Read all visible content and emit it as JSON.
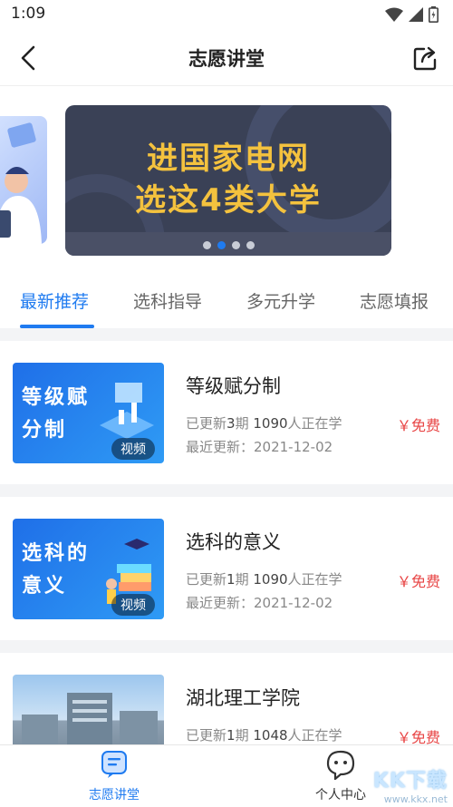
{
  "status": {
    "time": "1:09"
  },
  "header": {
    "title": "志愿讲堂"
  },
  "banner": {
    "line1": "进国家电网",
    "line2": "选这4类大学"
  },
  "tabs": [
    "最新推荐",
    "选科指导",
    "多元升学",
    "志愿填报"
  ],
  "courses": [
    {
      "thumb_text1": "等级赋",
      "thumb_text2": "分制",
      "badge": "视频",
      "title": "等级赋分制",
      "updated_prefix": "已更新",
      "updated_count": "3",
      "updated_unit": "期",
      "learners": "1090",
      "learners_suffix": "人正在学",
      "date": "最近更新：2021-12-02",
      "price": "￥免费"
    },
    {
      "thumb_text1": "选科的",
      "thumb_text2": "意义",
      "badge": "视频",
      "title": "选科的意义",
      "updated_prefix": "已更新",
      "updated_count": "1",
      "updated_unit": "期",
      "learners": "1090",
      "learners_suffix": "人正在学",
      "date": "最近更新：2021-12-02",
      "price": "￥免费"
    },
    {
      "title": "湖北理工学院",
      "updated_prefix": "已更新",
      "updated_count": "1",
      "updated_unit": "期",
      "learners": "1048",
      "learners_suffix": "人正在学",
      "price": "￥免费"
    }
  ],
  "tabbar": {
    "lecture": "志愿讲堂",
    "profile": "个人中心"
  },
  "watermark": {
    "big": "KK下载",
    "small": "www.kkx.net"
  },
  "colors": {
    "accent": "#1f7bf0",
    "price": "#e84545",
    "banner_text": "#f4c23e"
  }
}
